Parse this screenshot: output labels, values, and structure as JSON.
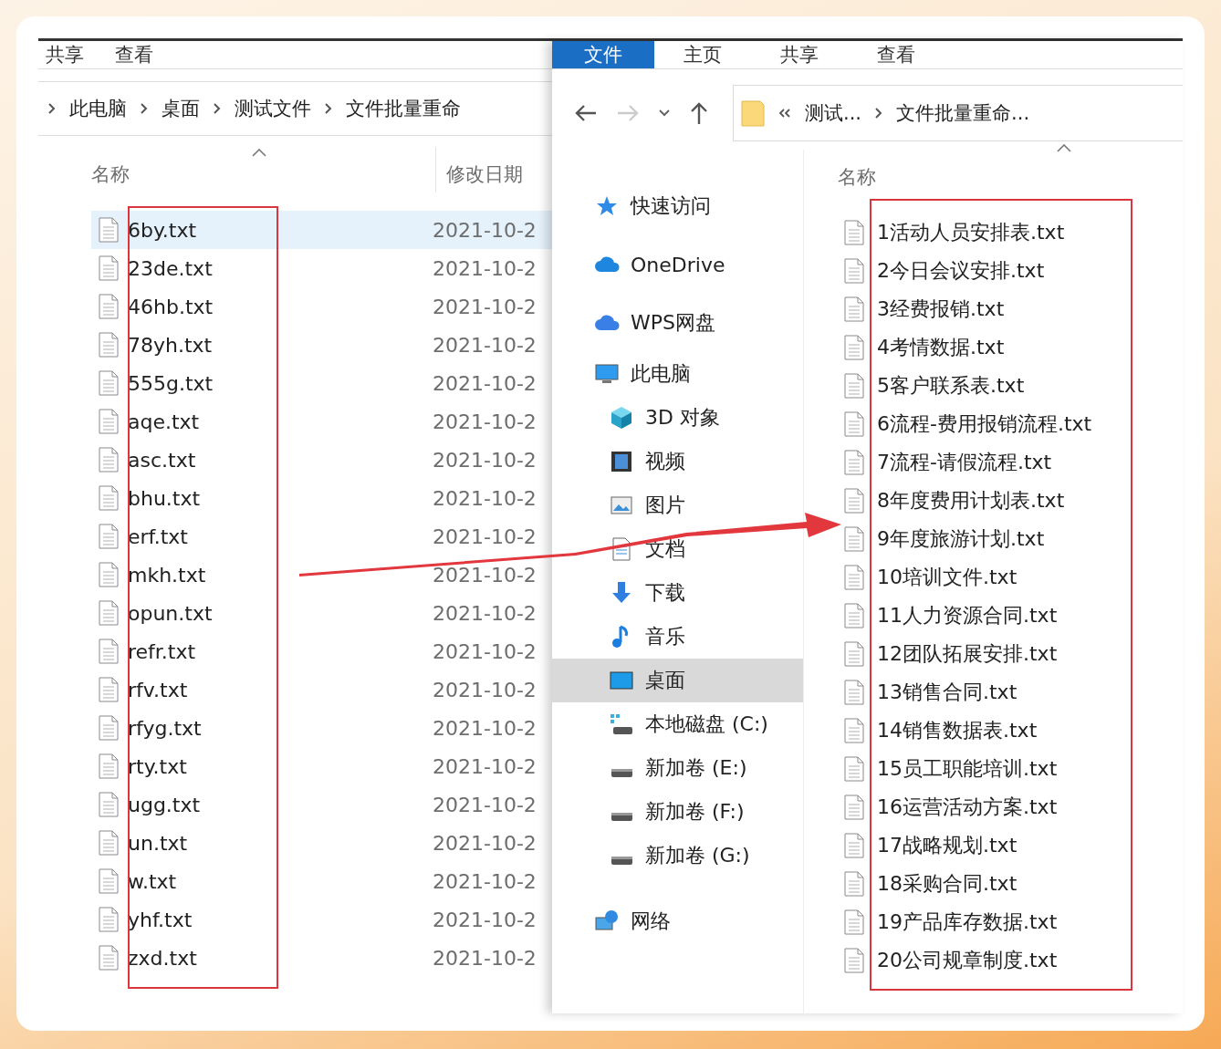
{
  "left_window": {
    "ribbon_tabs": [
      {
        "label": "共享",
        "selected": false
      },
      {
        "label": "查看",
        "selected": false
      }
    ],
    "breadcrumb": [
      "此电脑",
      "桌面",
      "测试文件",
      "文件批量重命"
    ],
    "columns": [
      "名称",
      "修改日期"
    ],
    "rows": [
      {
        "name": "6by.txt",
        "date": "2021-10-2",
        "selected": true
      },
      {
        "name": "23de.txt",
        "date": "2021-10-2",
        "selected": false
      },
      {
        "name": "46hb.txt",
        "date": "2021-10-2",
        "selected": false
      },
      {
        "name": "78yh.txt",
        "date": "2021-10-2",
        "selected": false
      },
      {
        "name": "555g.txt",
        "date": "2021-10-2",
        "selected": false
      },
      {
        "name": "aqe.txt",
        "date": "2021-10-2",
        "selected": false
      },
      {
        "name": "asc.txt",
        "date": "2021-10-2",
        "selected": false
      },
      {
        "name": "bhu.txt",
        "date": "2021-10-2",
        "selected": false
      },
      {
        "name": "erf.txt",
        "date": "2021-10-2",
        "selected": false
      },
      {
        "name": "mkh.txt",
        "date": "2021-10-2",
        "selected": false
      },
      {
        "name": "opun.txt",
        "date": "2021-10-2",
        "selected": false
      },
      {
        "name": "refr.txt",
        "date": "2021-10-2",
        "selected": false
      },
      {
        "name": "rfv.txt",
        "date": "2021-10-2",
        "selected": false
      },
      {
        "name": "rfyg.txt",
        "date": "2021-10-2",
        "selected": false
      },
      {
        "name": "rty.txt",
        "date": "2021-10-2",
        "selected": false
      },
      {
        "name": "ugg.txt",
        "date": "2021-10-2",
        "selected": false
      },
      {
        "name": "un.txt",
        "date": "2021-10-2",
        "selected": false
      },
      {
        "name": "w.txt",
        "date": "2021-10-2",
        "selected": false
      },
      {
        "name": "yhf.txt",
        "date": "2021-10-2",
        "selected": false
      },
      {
        "name": "zxd.txt",
        "date": "2021-10-2",
        "selected": false
      }
    ]
  },
  "right_window": {
    "ribbon_tabs": [
      {
        "label": "文件",
        "selected": true
      },
      {
        "label": "主页",
        "selected": false
      },
      {
        "label": "共享",
        "selected": false
      },
      {
        "label": "查看",
        "selected": false
      }
    ],
    "address": [
      "测试...",
      "文件批量重命..."
    ],
    "nav_pane": [
      {
        "label": "快速访问",
        "kind": "star",
        "selected": false
      },
      {
        "label": "OneDrive",
        "kind": "cloud",
        "selected": false
      },
      {
        "label": "WPS网盘",
        "kind": "cloud2",
        "selected": false
      },
      {
        "label": "此电脑",
        "kind": "pc",
        "selected": false,
        "children": [
          {
            "label": "3D 对象",
            "kind": "cube",
            "selected": false
          },
          {
            "label": "视频",
            "kind": "film",
            "selected": false
          },
          {
            "label": "图片",
            "kind": "image",
            "selected": false
          },
          {
            "label": "文档",
            "kind": "doc",
            "selected": false
          },
          {
            "label": "下载",
            "kind": "download",
            "selected": false
          },
          {
            "label": "音乐",
            "kind": "music",
            "selected": false
          },
          {
            "label": "桌面",
            "kind": "desktop",
            "selected": true
          },
          {
            "label": "本地磁盘 (C:)",
            "kind": "sysdrive",
            "selected": false
          },
          {
            "label": "新加卷 (E:)",
            "kind": "drive",
            "selected": false
          },
          {
            "label": "新加卷 (F:)",
            "kind": "drive",
            "selected": false
          },
          {
            "label": "新加卷 (G:)",
            "kind": "drive",
            "selected": false
          }
        ]
      },
      {
        "label": "网络",
        "kind": "network",
        "selected": false
      }
    ],
    "column": "名称",
    "files": [
      "1活动人员安排表.txt",
      "2今日会议安排.txt",
      "3经费报销.txt",
      "4考情数据.txt",
      "5客户联系表.txt",
      "6流程-费用报销流程.txt",
      "7流程-请假流程.txt",
      "8年度费用计划表.txt",
      "9年度旅游计划.txt",
      "10培训文件.txt",
      "11人力资源合同.txt",
      "12团队拓展安排.txt",
      "13销售合同.txt",
      "14销售数据表.txt",
      "15员工职能培训.txt",
      "16运营活动方案.txt",
      "17战略规划.txt",
      "18采购合同.txt",
      "19产品库存数据.txt",
      "20公司规章制度.txt"
    ]
  }
}
